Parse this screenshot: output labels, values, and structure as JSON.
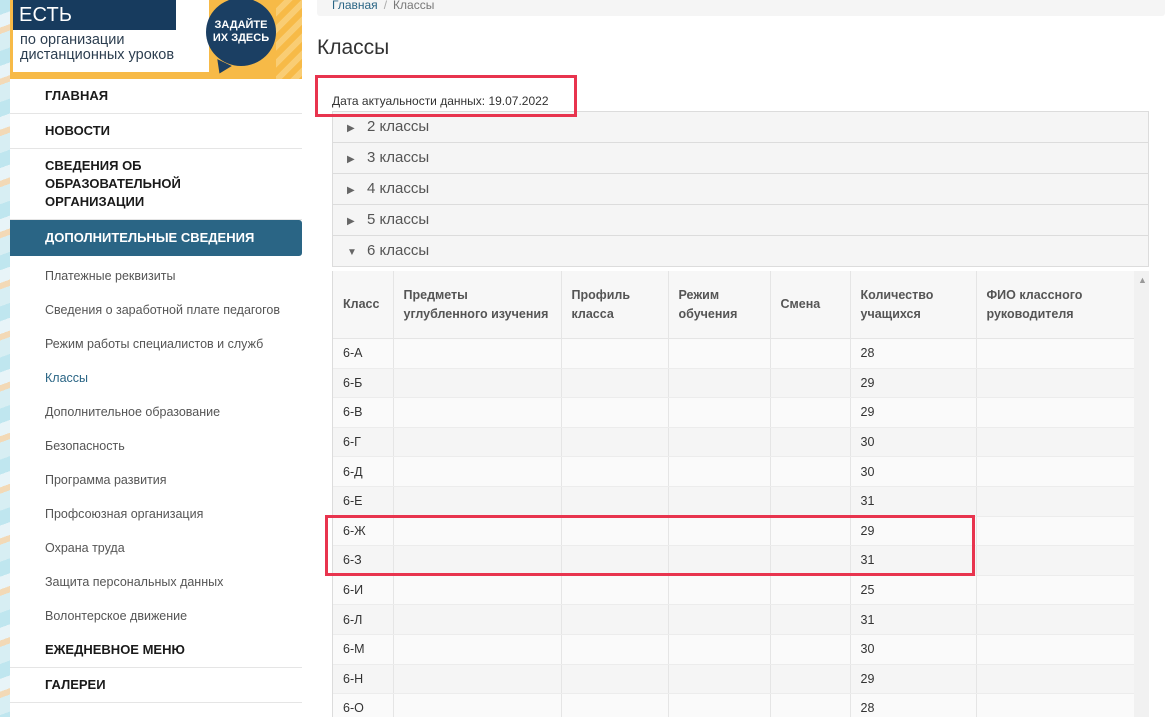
{
  "banner": {
    "title": "ЕСТЬ ВОПРОСЫ",
    "subtitle_line1": "по организации",
    "subtitle_line2": "дистанционных уроков",
    "bubble_line1": "ЗАДАЙТЕ",
    "bubble_line2": "ИХ ЗДЕСЬ"
  },
  "breadcrumb": {
    "home": "Главная",
    "separator": "/",
    "current": "Классы"
  },
  "sidebar": {
    "top_items": [
      {
        "label": "ГЛАВНАЯ"
      },
      {
        "label": "НОВОСТИ"
      },
      {
        "label": "СВЕДЕНИЯ ОБ ОБРАЗОВАТЕЛЬНОЙ ОРГАНИЗАЦИИ"
      }
    ],
    "active_item": {
      "label": "ДОПОЛНИТЕЛЬНЫЕ СВЕДЕНИЯ"
    },
    "sub_items": [
      {
        "label": "Платежные реквизиты"
      },
      {
        "label": "Сведения о заработной плате педагогов"
      },
      {
        "label": "Режим работы специалистов и служб"
      },
      {
        "label": "Классы"
      },
      {
        "label": "Дополнительное образование"
      },
      {
        "label": "Безопасность"
      },
      {
        "label": "Программа развития"
      },
      {
        "label": "Профсоюзная организация"
      },
      {
        "label": "Охрана труда"
      },
      {
        "label": "Защита персональных данных"
      },
      {
        "label": "Волонтерское движение"
      }
    ],
    "bottom_items": [
      {
        "label": "ЕЖЕДНЕВНОЕ МЕНЮ"
      },
      {
        "label": "ГАЛЕРЕИ"
      }
    ]
  },
  "main": {
    "title": "Классы",
    "date_text": "Дата актуальности данных: 19.07.2022",
    "accordion": [
      {
        "label": "2 классы",
        "arrow": "▶"
      },
      {
        "label": "3 классы",
        "arrow": "▶"
      },
      {
        "label": "4 классы",
        "arrow": "▶"
      },
      {
        "label": "5 классы",
        "arrow": "▶"
      },
      {
        "label": "6 классы",
        "arrow": "▼"
      }
    ],
    "table": {
      "headers": [
        "Класс",
        "Предметы углубленного изучения",
        "Профиль класса",
        "Режим обучения",
        "Смена",
        "Количество учащихся",
        "ФИО классного руководителя"
      ],
      "rows": [
        [
          "6-А",
          "",
          "",
          "",
          "",
          "28",
          ""
        ],
        [
          "6-Б",
          "",
          "",
          "",
          "",
          "29",
          ""
        ],
        [
          "6-В",
          "",
          "",
          "",
          "",
          "29",
          ""
        ],
        [
          "6-Г",
          "",
          "",
          "",
          "",
          "30",
          ""
        ],
        [
          "6-Д",
          "",
          "",
          "",
          "",
          "30",
          ""
        ],
        [
          "6-Е",
          "",
          "",
          "",
          "",
          "31",
          ""
        ],
        [
          "6-Ж",
          "",
          "",
          "",
          "",
          "29",
          ""
        ],
        [
          "6-З",
          "",
          "",
          "",
          "",
          "31",
          ""
        ],
        [
          "6-И",
          "",
          "",
          "",
          "",
          "25",
          ""
        ],
        [
          "6-Л",
          "",
          "",
          "",
          "",
          "31",
          ""
        ],
        [
          "6-М",
          "",
          "",
          "",
          "",
          "30",
          ""
        ],
        [
          "6-Н",
          "",
          "",
          "",
          "",
          "29",
          ""
        ],
        [
          "6-О",
          "",
          "",
          "",
          "",
          "28",
          ""
        ]
      ]
    }
  },
  "colors": {
    "active_nav": "#2a6585",
    "highlight": "#e8344e",
    "banner_bg": "#f7ba47",
    "banner_title_bg": "#173b5e"
  }
}
